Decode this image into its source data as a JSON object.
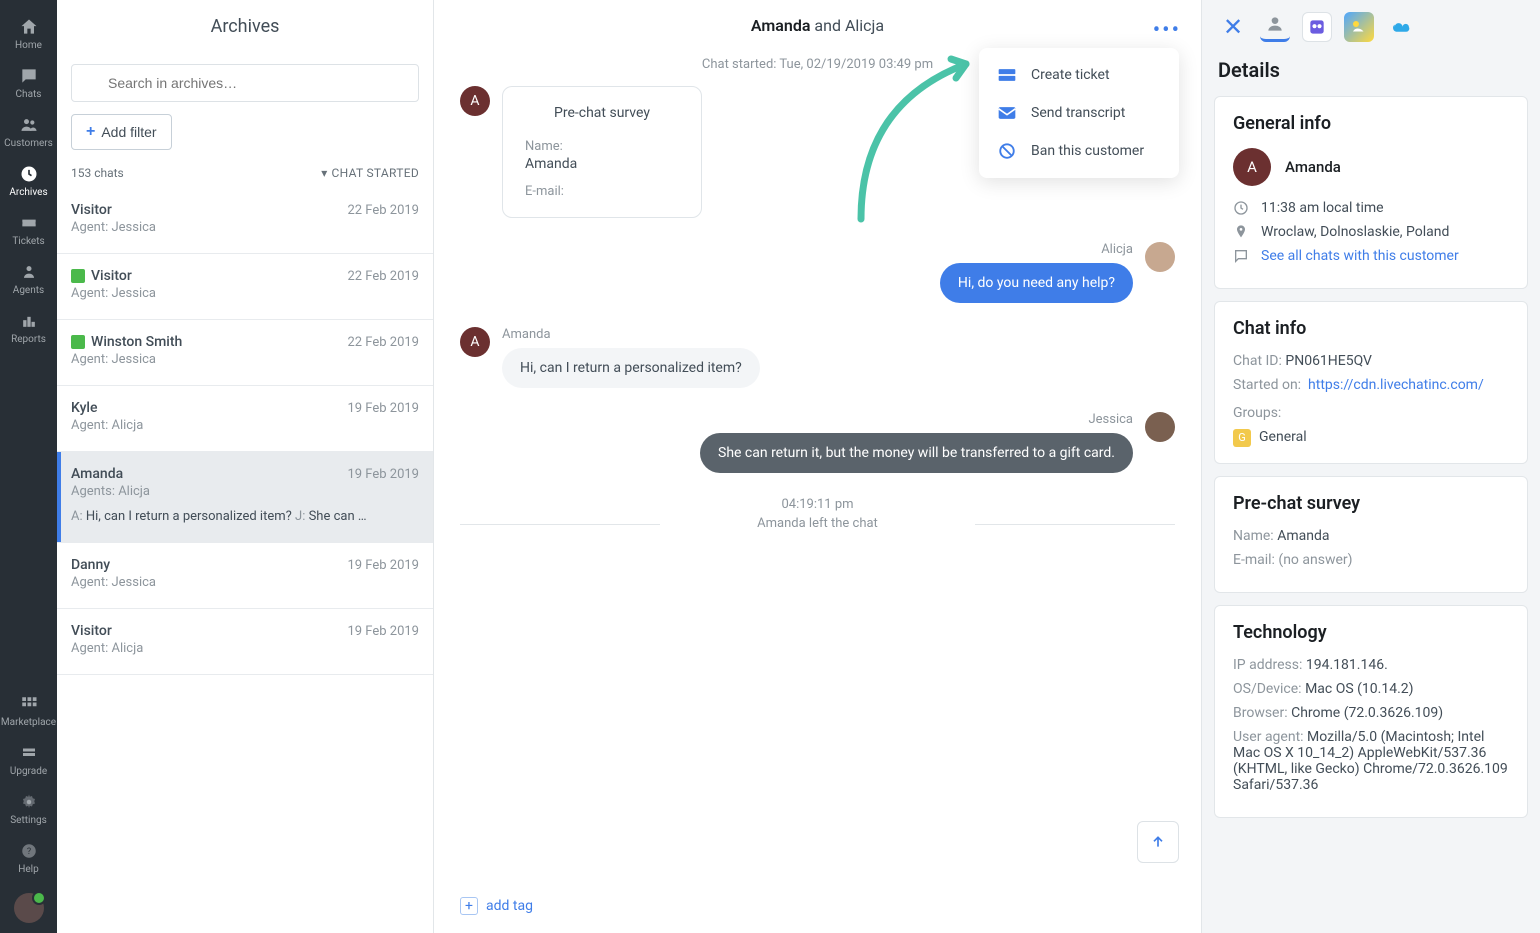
{
  "nav": {
    "items": [
      {
        "label": "Home"
      },
      {
        "label": "Chats"
      },
      {
        "label": "Customers"
      },
      {
        "label": "Archives"
      },
      {
        "label": "Tickets"
      },
      {
        "label": "Agents"
      },
      {
        "label": "Reports"
      }
    ],
    "bottom": [
      {
        "label": "Marketplace"
      },
      {
        "label": "Upgrade"
      },
      {
        "label": "Settings"
      },
      {
        "label": "Help"
      }
    ]
  },
  "archives": {
    "title": "Archives",
    "search_placeholder": "Search in archives…",
    "add_filter": "Add filter",
    "count": "153 chats",
    "sort": "CHAT STARTED",
    "items": [
      {
        "name": "Visitor",
        "date": "22 Feb 2019",
        "agent": "Agent: Jessica",
        "thumb": false
      },
      {
        "name": "Visitor",
        "date": "22 Feb 2019",
        "agent": "Agent: Jessica",
        "thumb": true
      },
      {
        "name": "Winston Smith",
        "date": "22 Feb 2019",
        "agent": "Agent: Jessica",
        "thumb": true
      },
      {
        "name": "Kyle",
        "date": "19 Feb 2019",
        "agent": "Agent: Alicja",
        "thumb": false
      },
      {
        "name": "Amanda",
        "date": "19 Feb 2019",
        "agent": "Agents: Alicja",
        "thumb": false,
        "selected": true,
        "preview_a": "A:",
        "preview_a_text": "Hi, can I return a personalized item?",
        "preview_j": "J:",
        "preview_j_text": "She can …"
      },
      {
        "name": "Danny",
        "date": "19 Feb 2019",
        "agent": "Agent: Jessica",
        "thumb": false
      },
      {
        "name": "Visitor",
        "date": "19 Feb 2019",
        "agent": "Agent: Alicja",
        "thumb": false
      }
    ]
  },
  "chat": {
    "title_bold": "Amanda",
    "title_rest": " and Alicja",
    "started": "Chat started: Tue, 02/19/2019 03:49 pm",
    "survey": {
      "title": "Pre-chat survey",
      "name_label": "Name:",
      "name_value": "Amanda",
      "email_label": "E-mail:"
    },
    "msg1": {
      "sender": "Alicja",
      "text": "Hi, do you need any help?"
    },
    "msg2": {
      "sender": "Amanda",
      "text": "Hi, can I return a personalized item?"
    },
    "msg3": {
      "sender": "Jessica",
      "text": "She can return it, but the money will be transferred to a gift card."
    },
    "time": "04:19:11 pm",
    "system": "Amanda left the chat",
    "add_tag": "add tag",
    "dropdown": {
      "create_ticket": "Create ticket",
      "send_transcript": "Send transcript",
      "ban": "Ban this customer"
    }
  },
  "details": {
    "title": "Details",
    "general": {
      "head": "General info",
      "name": "Amanda",
      "time": "11:38 am local time",
      "location": "Wroclaw, Dolnoslaskie, Poland",
      "see_all": "See all chats with this customer"
    },
    "chat_info": {
      "head": "Chat info",
      "chat_id_label": "Chat ID:",
      "chat_id": "PN061HE5QV",
      "started_label": "Started on:",
      "started_link": "https://cdn.livechatinc.com/",
      "groups_label": "Groups:",
      "group": "General"
    },
    "survey": {
      "head": "Pre-chat survey",
      "name_label": "Name:",
      "name": "Amanda",
      "email_label": "E-mail:",
      "email": "(no answer)"
    },
    "tech": {
      "head": "Technology",
      "ip_label": "IP address:",
      "ip": "194.181.146.",
      "os_label": "OS/Device:",
      "os": "Mac OS (10.14.2)",
      "browser_label": "Browser:",
      "browser": "Chrome (72.0.3626.109)",
      "ua_label": "User agent:",
      "ua": "Mozilla/5.0 (Macintosh; Intel Mac OS X 10_14_2) AppleWebKit/537.36 (KHTML, like Gecko) Chrome/72.0.3626.109 Safari/537.36"
    }
  }
}
